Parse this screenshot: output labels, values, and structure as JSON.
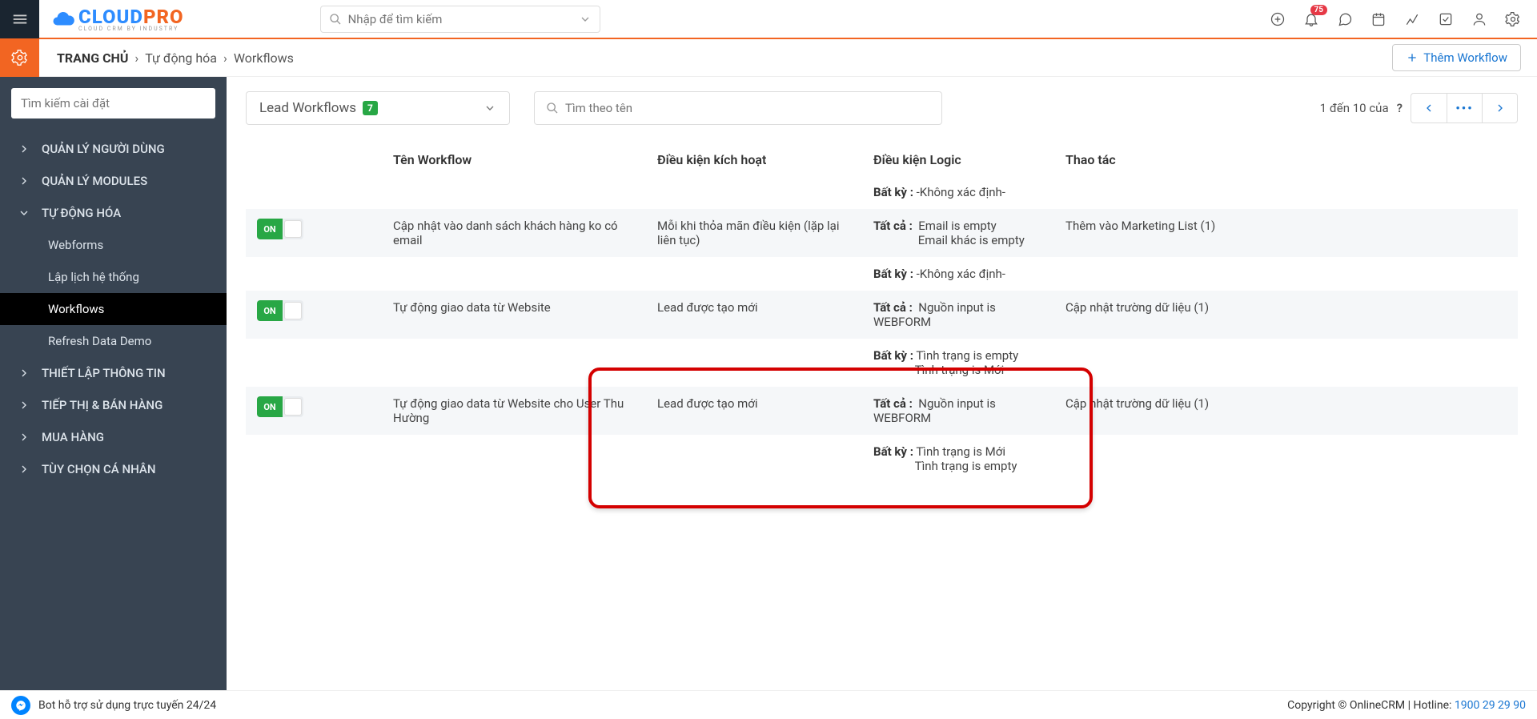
{
  "header": {
    "search_placeholder": "Nhập để tìm kiếm",
    "notif_count": "75"
  },
  "breadcrumb": {
    "home": "TRANG CHỦ",
    "l1": "Tự động hóa",
    "l2": "Workflows",
    "add_button": "Thêm Workflow"
  },
  "sidebar": {
    "search_placeholder": "Tìm kiếm cài đặt",
    "sections": [
      {
        "label": "QUẢN LÝ NGƯỜI DÙNG",
        "open": false
      },
      {
        "label": "QUẢN LÝ MODULES",
        "open": false
      },
      {
        "label": "TỰ ĐỘNG HÓA",
        "open": true,
        "children": [
          {
            "label": "Webforms"
          },
          {
            "label": "Lập lịch hệ thống"
          },
          {
            "label": "Workflows",
            "active": true
          },
          {
            "label": "Refresh Data Demo"
          }
        ]
      },
      {
        "label": "THIẾT LẬP THÔNG TIN",
        "open": false
      },
      {
        "label": "TIẾP THỊ & BÁN HÀNG",
        "open": false
      },
      {
        "label": "MUA HÀNG",
        "open": false
      },
      {
        "label": "TÙY CHỌN CÁ NHÂN",
        "open": false
      }
    ]
  },
  "toolbar": {
    "dropdown_label": "Lead Workflows",
    "dropdown_count": "7",
    "name_search_placeholder": "Tìm theo tên",
    "pager_text_1": "1 đến 10 của",
    "pager_text_q": "?"
  },
  "table": {
    "headers": [
      "Tên Workflow",
      "Điều kiện kích hoạt",
      "Điều kiện Logic",
      "Thao tác"
    ],
    "label_all": "Tất cả :",
    "label_any": "Bất kỳ :",
    "toggle_on": "ON",
    "rows": [
      {
        "name": "",
        "trigger": "",
        "logic_any": "-Không xác định-",
        "logic_all": "",
        "action": ""
      },
      {
        "name": "Cập nhật vào danh sách khách hàng ko có email",
        "trigger": "Mỗi khi thỏa mãn điều kiện (lặp lại liên tục)",
        "logic_all_1": "Email is empty",
        "logic_all_2": "Email khác is empty",
        "action": "Thêm vào Marketing List (1)"
      },
      {
        "name": "",
        "trigger": "",
        "logic_any": "-Không xác định-",
        "logic_all": "",
        "action": ""
      },
      {
        "name": "Tự động giao data từ Website",
        "trigger": "Lead được tạo mới",
        "logic_all_1": "Nguồn input is WEBFORM",
        "action": "Cập nhật trường dữ liệu (1)"
      },
      {
        "name": "",
        "trigger": "",
        "logic_any_1": "Tình trạng is empty",
        "logic_any_2": "Tình trạng is Mới",
        "action": ""
      },
      {
        "name": "Tự động giao data từ Website cho User Thu Hường",
        "trigger": "Lead được tạo mới",
        "logic_all_1": "Nguồn input is WEBFORM",
        "action": "Cập nhật trường dữ liệu (1)"
      },
      {
        "name": "",
        "trigger": "",
        "logic_any_1": "Tình trạng is Mới",
        "logic_any_2": "Tình trạng is empty",
        "action": ""
      }
    ]
  },
  "footer": {
    "bot_text": "Bot hỗ trợ sử dụng trực tuyến 24/24",
    "copyright": "Copyright © OnlineCRM | Hotline: ",
    "hotline": "1900 29 29 90"
  }
}
